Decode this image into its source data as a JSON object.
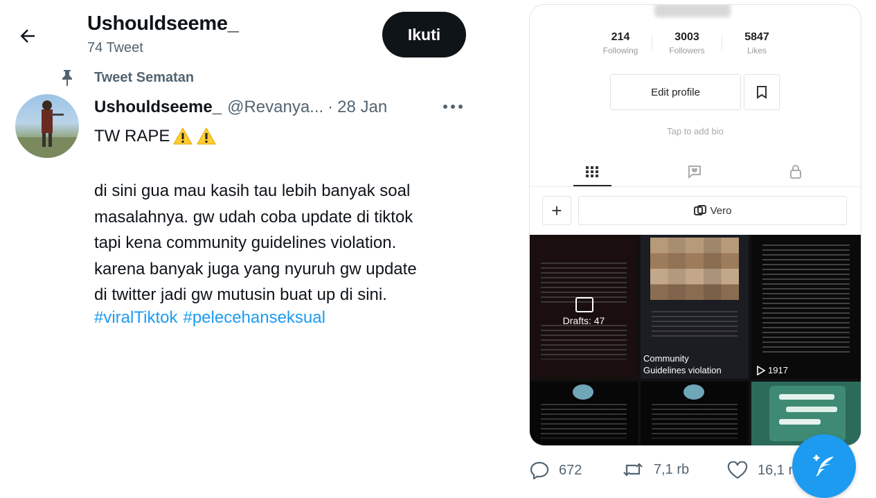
{
  "header": {
    "profile_name": "Ushouldseeme_",
    "tweet_count": "74 Tweet",
    "follow_label": "Ikuti"
  },
  "pinned": {
    "label": "Tweet Sematan"
  },
  "tweet": {
    "author_name": "Ushouldseeme_",
    "author_handle": "@Revanya...",
    "separator": "·",
    "date": "28 Jan",
    "first_line": "TW RAPE",
    "body_lines": [
      "di sini gua mau kasih tau lebih banyak soal",
      "masalahnya. gw udah coba update di tiktok",
      "tapi kena community guidelines violation.",
      "karena banyak juga yang nyuruh gw update",
      "di twitter jadi gw mutusin buat up di sini."
    ],
    "hashtags": [
      "#viralTiktok",
      "#pelecehanseksual"
    ]
  },
  "screenshot": {
    "stats": [
      {
        "num": "214",
        "label": "Following"
      },
      {
        "num": "3003",
        "label": "Followers"
      },
      {
        "num": "5847",
        "label": "Likes"
      }
    ],
    "edit_profile_label": "Edit profile",
    "bio_hint": "Tap to add bio",
    "vero_label": "Vero",
    "drafts_label": "Drafts: 47",
    "community_line1": "Community",
    "community_line2": "Guidelines violation",
    "play_count": "1917"
  },
  "actions": {
    "replies": "672",
    "retweets": "7,1 rb",
    "likes": "16,1 rb"
  },
  "colors": {
    "accent": "#1d9bf0",
    "text": "#0f1419",
    "muted": "#536471"
  }
}
